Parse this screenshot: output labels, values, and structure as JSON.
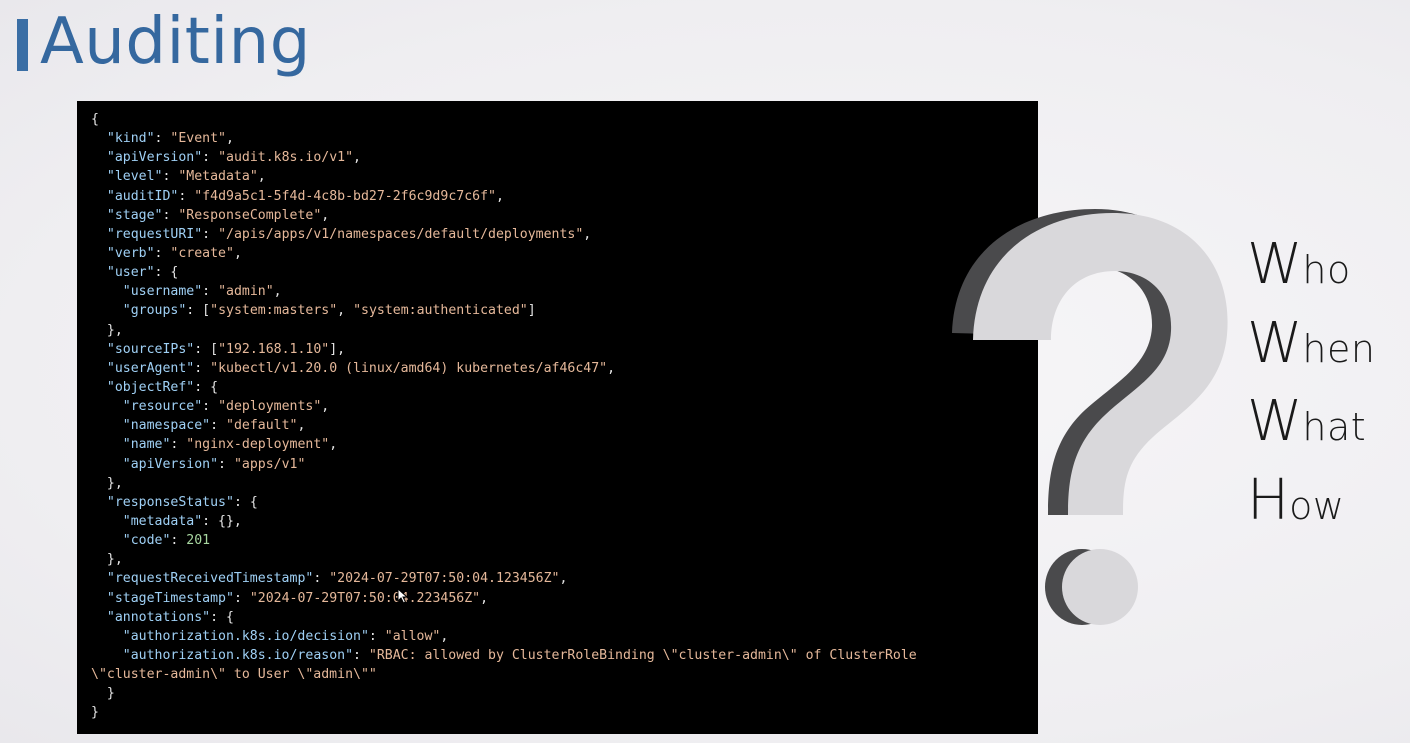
{
  "slide": {
    "title": "Auditing"
  },
  "code_lines": [
    [
      {
        "t": "p",
        "v": "{"
      }
    ],
    [
      {
        "t": "p",
        "v": "  "
      },
      {
        "t": "k",
        "v": "\"kind\""
      },
      {
        "t": "p",
        "v": ": "
      },
      {
        "t": "s",
        "v": "\"Event\""
      },
      {
        "t": "p",
        "v": ","
      }
    ],
    [
      {
        "t": "p",
        "v": "  "
      },
      {
        "t": "k",
        "v": "\"apiVersion\""
      },
      {
        "t": "p",
        "v": ": "
      },
      {
        "t": "s",
        "v": "\"audit.k8s.io/v1\""
      },
      {
        "t": "p",
        "v": ","
      }
    ],
    [
      {
        "t": "p",
        "v": "  "
      },
      {
        "t": "k",
        "v": "\"level\""
      },
      {
        "t": "p",
        "v": ": "
      },
      {
        "t": "s",
        "v": "\"Metadata\""
      },
      {
        "t": "p",
        "v": ","
      }
    ],
    [
      {
        "t": "p",
        "v": "  "
      },
      {
        "t": "k",
        "v": "\"auditID\""
      },
      {
        "t": "p",
        "v": ": "
      },
      {
        "t": "s",
        "v": "\"f4d9a5c1-5f4d-4c8b-bd27-2f6c9d9c7c6f\""
      },
      {
        "t": "p",
        "v": ","
      }
    ],
    [
      {
        "t": "p",
        "v": "  "
      },
      {
        "t": "k",
        "v": "\"stage\""
      },
      {
        "t": "p",
        "v": ": "
      },
      {
        "t": "s",
        "v": "\"ResponseComplete\""
      },
      {
        "t": "p",
        "v": ","
      }
    ],
    [
      {
        "t": "p",
        "v": "  "
      },
      {
        "t": "k",
        "v": "\"requestURI\""
      },
      {
        "t": "p",
        "v": ": "
      },
      {
        "t": "s",
        "v": "\"/apis/apps/v1/namespaces/default/deployments\""
      },
      {
        "t": "p",
        "v": ","
      }
    ],
    [
      {
        "t": "p",
        "v": "  "
      },
      {
        "t": "k",
        "v": "\"verb\""
      },
      {
        "t": "p",
        "v": ": "
      },
      {
        "t": "s",
        "v": "\"create\""
      },
      {
        "t": "p",
        "v": ","
      }
    ],
    [
      {
        "t": "p",
        "v": "  "
      },
      {
        "t": "k",
        "v": "\"user\""
      },
      {
        "t": "p",
        "v": ": {"
      }
    ],
    [
      {
        "t": "p",
        "v": "    "
      },
      {
        "t": "k",
        "v": "\"username\""
      },
      {
        "t": "p",
        "v": ": "
      },
      {
        "t": "s",
        "v": "\"admin\""
      },
      {
        "t": "p",
        "v": ","
      }
    ],
    [
      {
        "t": "p",
        "v": "    "
      },
      {
        "t": "k",
        "v": "\"groups\""
      },
      {
        "t": "p",
        "v": ": ["
      },
      {
        "t": "s",
        "v": "\"system:masters\""
      },
      {
        "t": "p",
        "v": ", "
      },
      {
        "t": "s",
        "v": "\"system:authenticated\""
      },
      {
        "t": "p",
        "v": "]"
      }
    ],
    [
      {
        "t": "p",
        "v": "  },"
      }
    ],
    [
      {
        "t": "p",
        "v": "  "
      },
      {
        "t": "k",
        "v": "\"sourceIPs\""
      },
      {
        "t": "p",
        "v": ": ["
      },
      {
        "t": "s",
        "v": "\"192.168.1.10\""
      },
      {
        "t": "p",
        "v": "],"
      }
    ],
    [
      {
        "t": "p",
        "v": "  "
      },
      {
        "t": "k",
        "v": "\"userAgent\""
      },
      {
        "t": "p",
        "v": ": "
      },
      {
        "t": "s",
        "v": "\"kubectl/v1.20.0 (linux/amd64) kubernetes/af46c47\""
      },
      {
        "t": "p",
        "v": ","
      }
    ],
    [
      {
        "t": "p",
        "v": "  "
      },
      {
        "t": "k",
        "v": "\"objectRef\""
      },
      {
        "t": "p",
        "v": ": {"
      }
    ],
    [
      {
        "t": "p",
        "v": "    "
      },
      {
        "t": "k",
        "v": "\"resource\""
      },
      {
        "t": "p",
        "v": ": "
      },
      {
        "t": "s",
        "v": "\"deployments\""
      },
      {
        "t": "p",
        "v": ","
      }
    ],
    [
      {
        "t": "p",
        "v": "    "
      },
      {
        "t": "k",
        "v": "\"namespace\""
      },
      {
        "t": "p",
        "v": ": "
      },
      {
        "t": "s",
        "v": "\"default\""
      },
      {
        "t": "p",
        "v": ","
      }
    ],
    [
      {
        "t": "p",
        "v": "    "
      },
      {
        "t": "k",
        "v": "\"name\""
      },
      {
        "t": "p",
        "v": ": "
      },
      {
        "t": "s",
        "v": "\"nginx-deployment\""
      },
      {
        "t": "p",
        "v": ","
      }
    ],
    [
      {
        "t": "p",
        "v": "    "
      },
      {
        "t": "k",
        "v": "\"apiVersion\""
      },
      {
        "t": "p",
        "v": ": "
      },
      {
        "t": "s",
        "v": "\"apps/v1\""
      }
    ],
    [
      {
        "t": "p",
        "v": "  },"
      }
    ],
    [
      {
        "t": "p",
        "v": "  "
      },
      {
        "t": "k",
        "v": "\"responseStatus\""
      },
      {
        "t": "p",
        "v": ": {"
      }
    ],
    [
      {
        "t": "p",
        "v": "    "
      },
      {
        "t": "k",
        "v": "\"metadata\""
      },
      {
        "t": "p",
        "v": ": {},"
      }
    ],
    [
      {
        "t": "p",
        "v": "    "
      },
      {
        "t": "k",
        "v": "\"code\""
      },
      {
        "t": "p",
        "v": ": "
      },
      {
        "t": "n",
        "v": "201"
      }
    ],
    [
      {
        "t": "p",
        "v": "  },"
      }
    ],
    [
      {
        "t": "p",
        "v": "  "
      },
      {
        "t": "k",
        "v": "\"requestReceivedTimestamp\""
      },
      {
        "t": "p",
        "v": ": "
      },
      {
        "t": "s",
        "v": "\"2024-07-29T07:50:04.123456Z\""
      },
      {
        "t": "p",
        "v": ","
      }
    ],
    [
      {
        "t": "p",
        "v": "  "
      },
      {
        "t": "k",
        "v": "\"stageTimestamp\""
      },
      {
        "t": "p",
        "v": ": "
      },
      {
        "t": "s",
        "v": "\"2024-07-29T07:50:04.223456Z\""
      },
      {
        "t": "p",
        "v": ","
      }
    ],
    [
      {
        "t": "p",
        "v": "  "
      },
      {
        "t": "k",
        "v": "\"annotations\""
      },
      {
        "t": "p",
        "v": ": {"
      }
    ],
    [
      {
        "t": "p",
        "v": "    "
      },
      {
        "t": "k",
        "v": "\"authorization.k8s.io/decision\""
      },
      {
        "t": "p",
        "v": ": "
      },
      {
        "t": "s",
        "v": "\"allow\""
      },
      {
        "t": "p",
        "v": ","
      }
    ],
    [
      {
        "t": "p",
        "v": "    "
      },
      {
        "t": "k",
        "v": "\"authorization.k8s.io/reason\""
      },
      {
        "t": "p",
        "v": ": "
      },
      {
        "t": "s",
        "v": "\"RBAC: allowed by ClusterRoleBinding \\\"cluster-admin\\\" of ClusterRole"
      }
    ],
    [
      {
        "t": "s",
        "v": "\\\"cluster-admin\\\" to User \\\"admin\\\"\""
      }
    ],
    [
      {
        "t": "p",
        "v": "  }"
      }
    ],
    [
      {
        "t": "p",
        "v": "}"
      }
    ]
  ],
  "questions": {
    "who": {
      "initial": "W",
      "rest": "ho"
    },
    "when": {
      "initial": "W",
      "rest": "hen"
    },
    "what": {
      "initial": "W",
      "rest": "hat"
    },
    "how": {
      "initial": "H",
      "rest": "ow"
    }
  },
  "decor": {
    "question_mark_icon": "question-mark-icon",
    "cursor_icon": "mouse-cursor-icon"
  },
  "colors": {
    "title": "#35689f",
    "accent_bar": "#3a6ea5",
    "code_bg": "#000000",
    "json_key": "#9fd0f5",
    "json_string": "#e5b89a",
    "json_number": "#a7d6a0",
    "qmark_light": "#d9d8db",
    "qmark_shadow": "#4a4a4c"
  }
}
